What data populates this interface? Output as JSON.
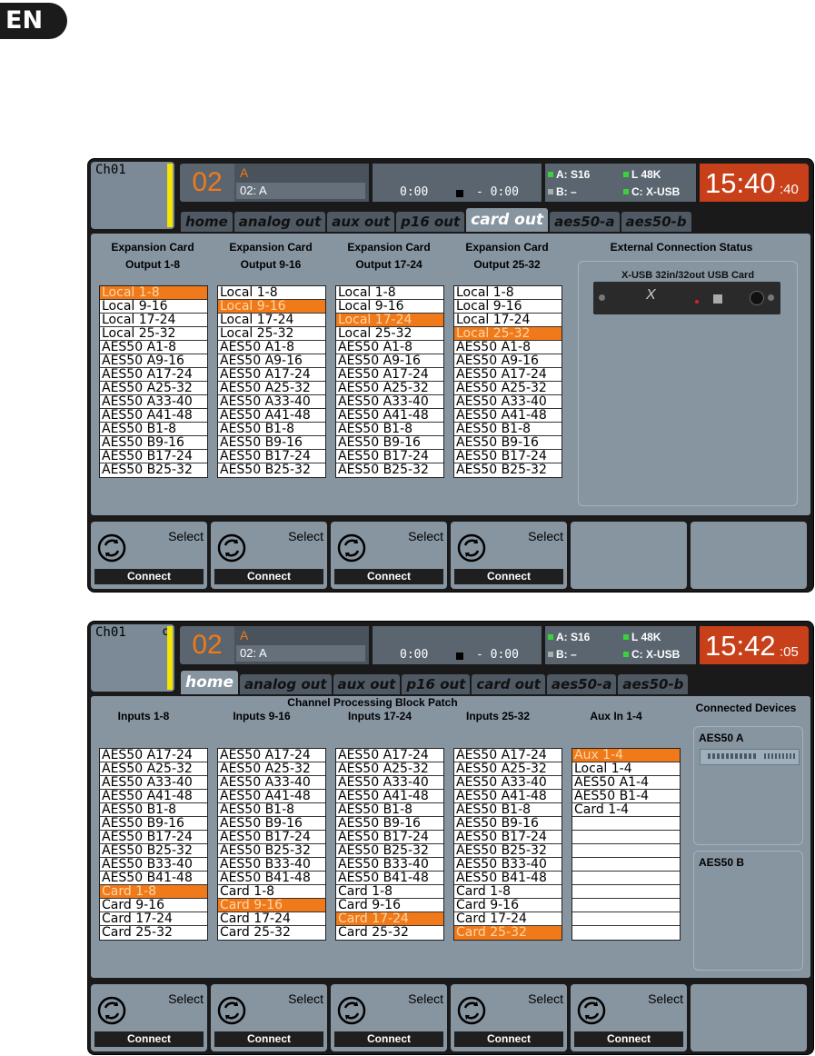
{
  "badge": "EN",
  "screen1": {
    "channel": "Ch01",
    "channel_extra": "",
    "number": "02",
    "name_top": "A",
    "name_bottom": "02: A",
    "time_elapsed": "0:00",
    "time_remaining": "- 0:00",
    "status_a": "A: S16",
    "status_b": "B:  –",
    "status_l": "L  48K",
    "status_c": "C: X-USB",
    "clock_big": "15:40",
    "clock_small": ":40",
    "tabs": [
      "home",
      "analog out",
      "aux out",
      "p16 out",
      "card out",
      "aes50-a",
      "aes50-b"
    ],
    "active_tab": "card out",
    "columns": [
      {
        "head1": "Expansion Card",
        "head2": "Output 1-8",
        "selected": 0,
        "items": [
          "Local 1-8",
          "Local 9-16",
          "Local 17-24",
          "Local 25-32",
          "AES50 A1-8",
          "AES50 A9-16",
          "AES50 A17-24",
          "AES50 A25-32",
          "AES50 A33-40",
          "AES50 A41-48",
          "AES50 B1-8",
          "AES50 B9-16",
          "AES50 B17-24",
          "AES50 B25-32"
        ]
      },
      {
        "head1": "Expansion Card",
        "head2": "Output  9-16",
        "selected": 1,
        "items": [
          "Local 1-8",
          "Local 9-16",
          "Local 17-24",
          "Local 25-32",
          "AES50 A1-8",
          "AES50 A9-16",
          "AES50 A17-24",
          "AES50 A25-32",
          "AES50 A33-40",
          "AES50 A41-48",
          "AES50 B1-8",
          "AES50 B9-16",
          "AES50 B17-24",
          "AES50 B25-32"
        ]
      },
      {
        "head1": "Expansion Card",
        "head2": "Output 17-24",
        "selected": 2,
        "items": [
          "Local 1-8",
          "Local 9-16",
          "Local 17-24",
          "Local 25-32",
          "AES50 A1-8",
          "AES50 A9-16",
          "AES50 A17-24",
          "AES50 A25-32",
          "AES50 A33-40",
          "AES50 A41-48",
          "AES50 B1-8",
          "AES50 B9-16",
          "AES50 B17-24",
          "AES50 B25-32"
        ]
      },
      {
        "head1": "Expansion Card",
        "head2": "Output  25-32",
        "selected": 3,
        "items": [
          "Local 1-8",
          "Local 9-16",
          "Local 17-24",
          "Local 25-32",
          "AES50 A1-8",
          "AES50 A9-16",
          "AES50 A17-24",
          "AES50 A25-32",
          "AES50 A33-40",
          "AES50 A41-48",
          "AES50 B1-8",
          "AES50 B9-16",
          "AES50 B17-24",
          "AES50 B25-32"
        ]
      }
    ],
    "ext_title": "External Connection Status",
    "ext_card_label": "X-USB   32in/32out USB Card",
    "softkeys": [
      {
        "select": "Select",
        "connect": "Connect"
      },
      {
        "select": "Select",
        "connect": "Connect"
      },
      {
        "select": "Select",
        "connect": "Connect"
      },
      {
        "select": "Select",
        "connect": "Connect"
      },
      {},
      {}
    ]
  },
  "screen2": {
    "channel": "Ch01",
    "channel_extra": "c",
    "number": "02",
    "name_top": "A",
    "name_bottom": "02: A",
    "time_elapsed": "0:00",
    "time_remaining": "- 0:00",
    "status_a": "A: S16",
    "status_b": "B:  –",
    "status_l": "L  48K",
    "status_c": "C: X-USB",
    "clock_big": "15:42",
    "clock_small": ":05",
    "tabs": [
      "home",
      "analog out",
      "aux out",
      "p16 out",
      "card out",
      "aes50-a",
      "aes50-b"
    ],
    "active_tab": "home",
    "panel_title": "Channel Processing Block Patch",
    "columns": [
      {
        "head": "Inputs 1-8",
        "selected": 10,
        "items": [
          "AES50 A17-24",
          "AES50 A25-32",
          "AES50 A33-40",
          "AES50 A41-48",
          "AES50 B1-8",
          "AES50 B9-16",
          "AES50 B17-24",
          "AES50 B25-32",
          "AES50 B33-40",
          "AES50 B41-48",
          "Card 1-8",
          "Card 9-16",
          "Card 17-24",
          "Card 25-32"
        ]
      },
      {
        "head": "Inputs 9-16",
        "selected": 11,
        "items": [
          "AES50 A17-24",
          "AES50 A25-32",
          "AES50 A33-40",
          "AES50 A41-48",
          "AES50 B1-8",
          "AES50 B9-16",
          "AES50 B17-24",
          "AES50 B25-32",
          "AES50 B33-40",
          "AES50 B41-48",
          "Card 1-8",
          "Card 9-16",
          "Card 17-24",
          "Card 25-32"
        ]
      },
      {
        "head": "Inputs 17-24",
        "selected": 12,
        "items": [
          "AES50 A17-24",
          "AES50 A25-32",
          "AES50 A33-40",
          "AES50 A41-48",
          "AES50 B1-8",
          "AES50 B9-16",
          "AES50 B17-24",
          "AES50 B25-32",
          "AES50 B33-40",
          "AES50 B41-48",
          "Card 1-8",
          "Card 9-16",
          "Card 17-24",
          "Card 25-32"
        ]
      },
      {
        "head": "Inputs 25-32",
        "selected": 13,
        "items": [
          "AES50 A17-24",
          "AES50 A25-32",
          "AES50 A33-40",
          "AES50 A41-48",
          "AES50 B1-8",
          "AES50 B9-16",
          "AES50 B17-24",
          "AES50 B25-32",
          "AES50 B33-40",
          "AES50 B41-48",
          "Card 1-8",
          "Card 9-16",
          "Card 17-24",
          "Card 25-32"
        ]
      },
      {
        "head": "Aux In 1-4",
        "selected": 0,
        "items": [
          "Aux 1-4",
          "Local 1-4",
          "AES50 A1-4",
          "AES50 B1-4",
          "Card 1-4",
          "",
          "",
          "",
          "",
          "",
          "",
          "",
          "",
          ""
        ]
      }
    ],
    "devices_title": "Connected Devices",
    "device_a": "AES50 A",
    "device_b": "AES50 B",
    "softkeys": [
      {
        "select": "Select",
        "connect": "Connect"
      },
      {
        "select": "Select",
        "connect": "Connect"
      },
      {
        "select": "Select",
        "connect": "Connect"
      },
      {
        "select": "Select",
        "connect": "Connect"
      },
      {
        "select": "Select",
        "connect": "Connect"
      },
      {}
    ]
  }
}
